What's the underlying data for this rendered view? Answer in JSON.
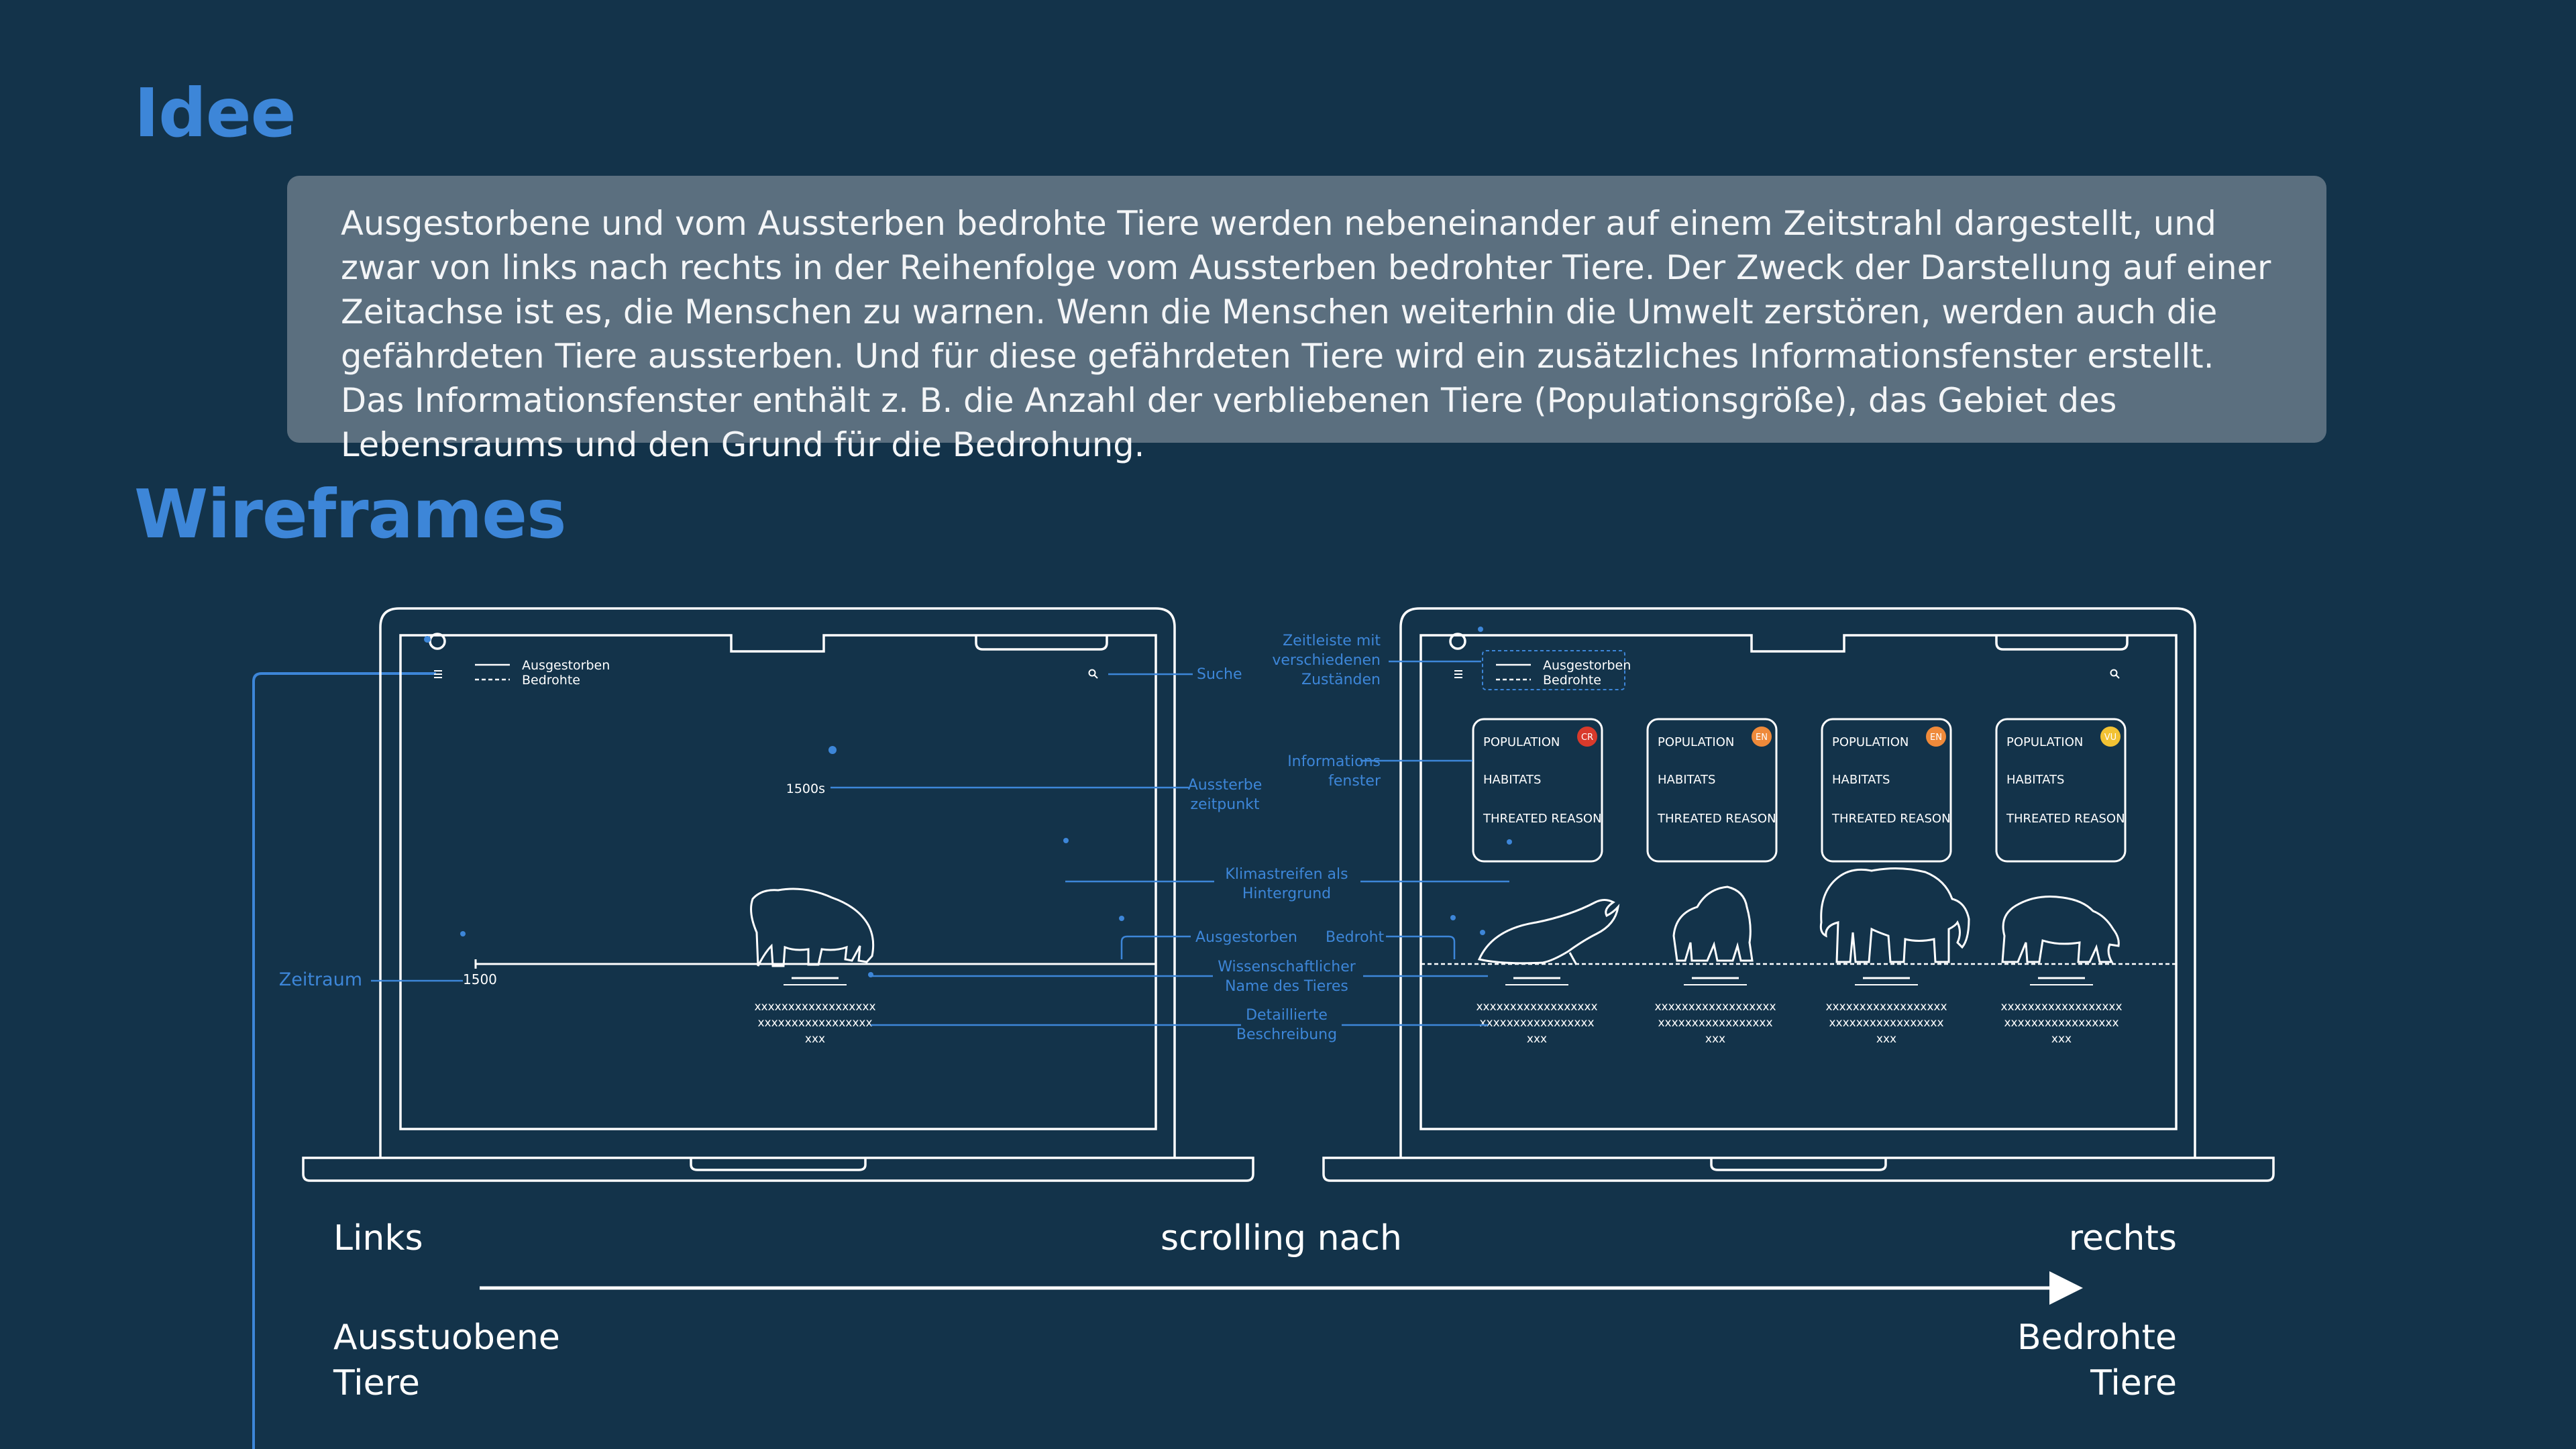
{
  "headings": {
    "idea": "Idee",
    "wireframes": "Wireframes"
  },
  "idea_text": "Ausgestorbene und vom Aussterben bedrohte Tiere werden nebeneinander auf einem Zeitstrahl dargestellt, und zwar von links nach rechts in der Reihenfolge vom Aussterben bedrohter Tiere. Der Zweck der Darstellung auf einer Zeitachse ist es, die Menschen zu warnen. Wenn die Menschen weiterhin die Umwelt zerstören, werden auch die gefährdeten Tiere aussterben. Und für diese gefährdeten Tiere wird ein zusätzliches Informationsfenster erstellt. Das Informationsfenster enthält z. B. die Anzahl der verbliebenen Tiere (Populationsgröße), das Gebiet des Lebensraums und den Grund für die Bedrohung.",
  "wireframe": {
    "legend": {
      "extinct": "Ausgestorben",
      "threatened": "Bedrohte"
    },
    "left_screen": {
      "year_marker": "1500s",
      "axis_start": "1500"
    },
    "desc_lines": [
      "xxxxxxxxxxxxxxxxxx",
      "xxxxxxxxxxxxxxxxx",
      "xxx"
    ],
    "annotations": {
      "zeitraum": "Zeitraum",
      "suche": "Suche",
      "aussterbe_1": "Aussterbe",
      "aussterbe_2": "zeitpunkt",
      "klima_1": "Klimastreifen als",
      "klima_2": "Hintergrund",
      "ausgestorben": "Ausgestorben",
      "bedroht": "Bedroht",
      "wiss_1": "Wissenschaftlicher",
      "wiss_2": "Name des Tieres",
      "detail_1": "Detaillierte",
      "detail_2": "Beschreibung",
      "zeitleiste_1": "Zeitleiste mit",
      "zeitleiste_2": "verschiedenen",
      "zeitleiste_3": "Zuständen",
      "info_1": "Informations",
      "info_2": "fenster"
    },
    "card_labels": {
      "population": "POPULATION",
      "habitats": "HABITATS",
      "threat": "THREATED REASON"
    },
    "cards": [
      {
        "badge": "CR",
        "badge_color": "#d93a2b"
      },
      {
        "badge": "EN",
        "badge_color": "#ef8a3a"
      },
      {
        "badge": "EN",
        "badge_color": "#ef8a3a"
      },
      {
        "badge": "VU",
        "badge_color": "#f2c233"
      }
    ],
    "animals": {
      "left": "hippo-icon",
      "right": [
        "whale-icon",
        "gorilla-icon",
        "elephant-icon",
        "polar-bear-icon"
      ]
    },
    "colors": {
      "background": "#13334a",
      "accent": "#3d86d8",
      "line": "#ffffff"
    }
  },
  "bottom": {
    "left": "Links",
    "middle": "scrolling nach",
    "right": "rechts",
    "left_sub_1": "Ausstuobene",
    "left_sub_2": "Tiere",
    "right_sub_1": "Bedrohte",
    "right_sub_2": "Tiere"
  }
}
